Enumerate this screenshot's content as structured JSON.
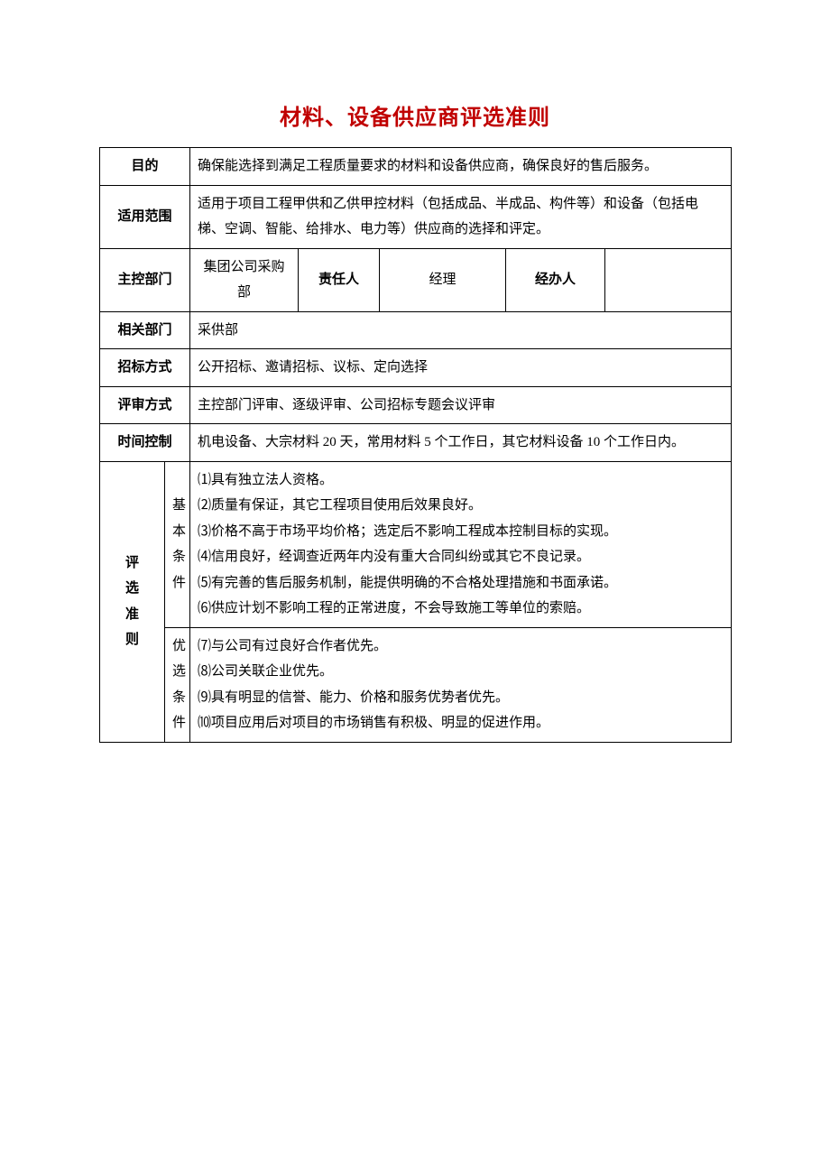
{
  "title": "材料、设备供应商评选准则",
  "rows": {
    "purpose": {
      "label": "目的",
      "value": "确保能选择到满足工程质量要求的材料和设备供应商，确保良好的售后服务。"
    },
    "scope": {
      "label": "适用范围",
      "value": "适用于项目工程甲供和乙供甲控材料（包括成品、半成品、构件等）和设备（包括电梯、空调、智能、给排水、电力等）供应商的选择和评定。"
    },
    "mainDept": {
      "label": "主控部门",
      "dept": "集团公司采购部",
      "respLabel": "责任人",
      "respValue": "经理",
      "handlerLabel": "经办人",
      "handlerValue": ""
    },
    "relDept": {
      "label": "相关部门",
      "value": "采供部"
    },
    "bidMode": {
      "label": "招标方式",
      "value": "公开招标、邀请招标、议标、定向选择"
    },
    "review": {
      "label": "评审方式",
      "value": "主控部门评审、逐级评审、公司招标专题会议评审"
    },
    "time": {
      "label": "时间控制",
      "value": "机电设备、大宗材料 20 天，常用材料 5 个工作日，其它材料设备 10 个工作日内。"
    }
  },
  "criteria": {
    "label": "评选准则",
    "basic": {
      "label": "基本条件",
      "items": [
        "⑴具有独立法人资格。",
        "⑵质量有保证，其它工程项目使用后效果良好。",
        "⑶价格不高于市场平均价格；选定后不影响工程成本控制目标的实现。",
        "⑷信用良好，经调查近两年内没有重大合同纠纷或其它不良记录。",
        "⑸有完善的售后服务机制，能提供明确的不合格处理措施和书面承诺。",
        "⑹供应计划不影响工程的正常进度，不会导致施工等单位的索赔。"
      ]
    },
    "preferred": {
      "label": "优选条件",
      "items": [
        "⑺与公司有过良好合作者优先。",
        "⑻公司关联企业优先。",
        "⑼具有明显的信誉、能力、价格和服务优势者优先。",
        "⑽项目应用后对项目的市场销售有积极、明显的促进作用。"
      ]
    }
  }
}
